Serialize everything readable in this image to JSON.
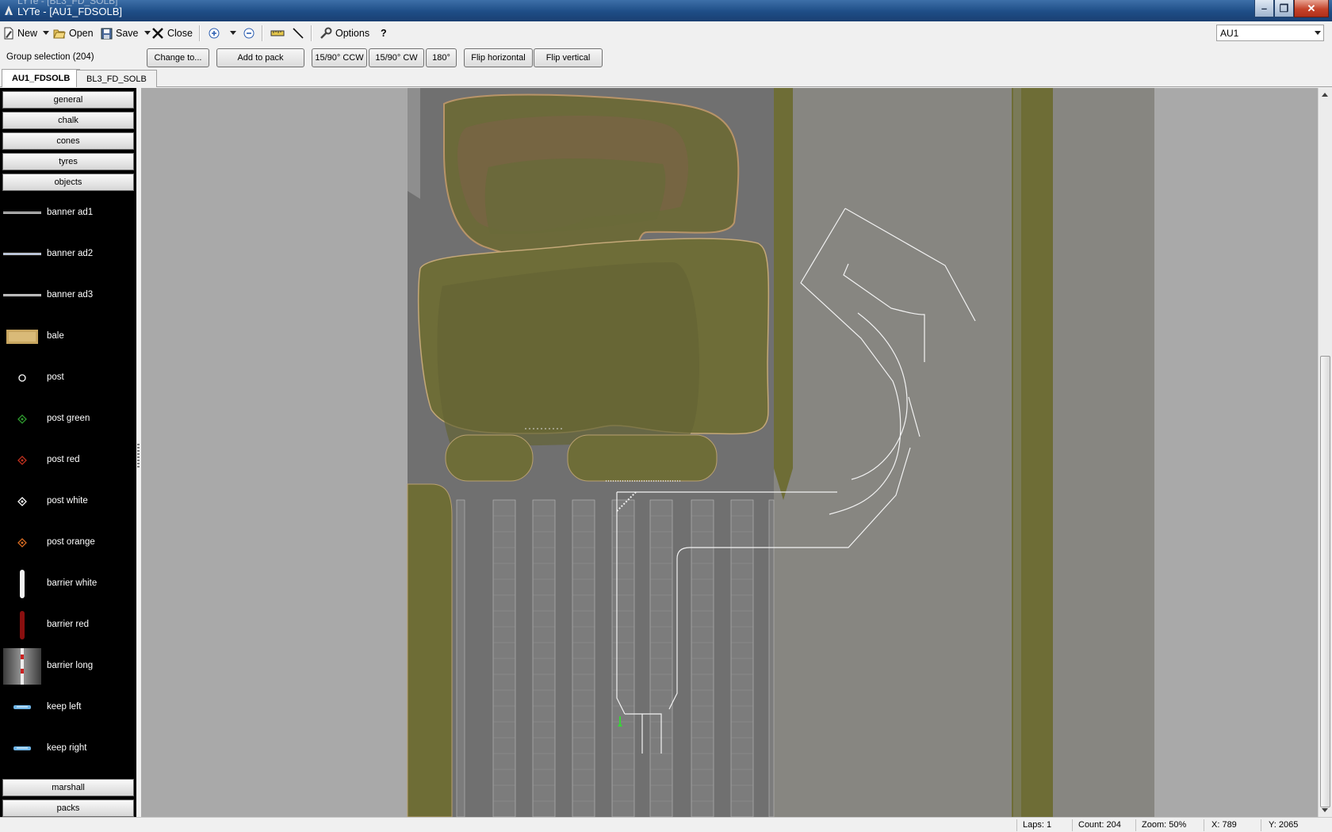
{
  "window": {
    "ghost_title": "LYTe - [BL3_FD_SOLB]",
    "title": "LYTe - [AU1_FDSOLB]",
    "minimize_label": "–",
    "maximize_label": "❐",
    "close_label": "✕"
  },
  "toolbar": {
    "new_label": "New",
    "open_label": "Open",
    "save_label": "Save",
    "close_label": "Close",
    "options_label": "Options",
    "help_label": "?",
    "track_select": "AU1"
  },
  "selection_bar": {
    "group_label": "Group selection (204)",
    "change_to": "Change to...",
    "add_to_pack": "Add to pack",
    "rotate_ccw": "15/90° CCW",
    "rotate_cw": "15/90° CW",
    "rotate_180": "180°",
    "flip_horizontal": "Flip horizontal",
    "flip_vertical": "Flip vertical"
  },
  "tabs": [
    {
      "label": "AU1_FDSOLB",
      "active": true
    },
    {
      "label": "BL3_FD_SOLB",
      "active": false
    }
  ],
  "sidebar": {
    "categories": [
      "general",
      "chalk",
      "cones",
      "tyres",
      "objects"
    ],
    "objects": [
      {
        "label": "banner ad1",
        "icon": "banner-icon"
      },
      {
        "label": "banner ad2",
        "icon": "banner-icon"
      },
      {
        "label": "banner ad3",
        "icon": "banner-icon"
      },
      {
        "label": "bale",
        "icon": "bale-icon"
      },
      {
        "label": "post",
        "icon": "post-icon"
      },
      {
        "label": "post green",
        "icon": "post-green-icon"
      },
      {
        "label": "post red",
        "icon": "post-red-icon"
      },
      {
        "label": "post white",
        "icon": "post-white-icon"
      },
      {
        "label": "post orange",
        "icon": "post-orange-icon"
      },
      {
        "label": "barrier white",
        "icon": "barrier-white-icon"
      },
      {
        "label": "barrier red",
        "icon": "barrier-red-icon"
      },
      {
        "label": "barrier long",
        "icon": "barrier-long-icon"
      },
      {
        "label": "keep left",
        "icon": "keep-left-icon"
      },
      {
        "label": "keep right",
        "icon": "keep-right-icon"
      }
    ],
    "bottom_categories": [
      "marshall",
      "packs"
    ]
  },
  "status": {
    "laps": "Laps: 1",
    "count": "Count: 204",
    "zoom": "Zoom: 50%",
    "x": "X: 789",
    "y": "Y: 2065"
  },
  "colors": {
    "grass": "#6f6e35",
    "asphalt": "#6f6f6f",
    "canvas_bg": "#a9a9a9",
    "lines": "#ffffff"
  }
}
